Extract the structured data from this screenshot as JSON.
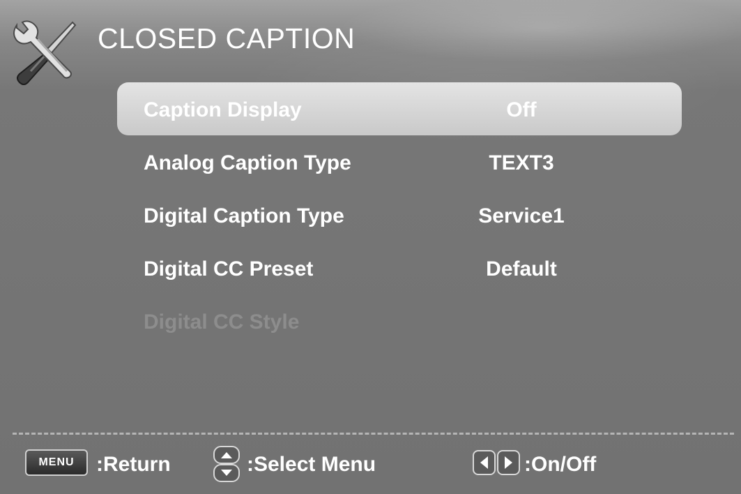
{
  "header": {
    "title": "CLOSED CAPTION",
    "icon": "wrench-screwdriver-icon"
  },
  "menu": {
    "selected_index": 0,
    "items": [
      {
        "label": "Caption Display",
        "value": "Off",
        "state": "selected"
      },
      {
        "label": "Analog Caption Type",
        "value": "TEXT3",
        "state": "normal"
      },
      {
        "label": "Digital Caption Type",
        "value": "Service1",
        "state": "normal"
      },
      {
        "label": "Digital CC Preset",
        "value": "Default",
        "state": "normal"
      },
      {
        "label": "Digital CC Style",
        "value": "",
        "state": "disabled"
      }
    ]
  },
  "footer": {
    "menu_key": "MENU",
    "return_label": ":Return",
    "select_icon": "up-down-arrows-icon",
    "select_label": ":Select Menu",
    "toggle_icon": "left-right-arrows-icon",
    "toggle_label": ":On/Off"
  },
  "colors": {
    "background": "#787878",
    "highlight": "#d8d8d8",
    "text": "#ffffff",
    "disabled_text": "#8d8d8d"
  }
}
